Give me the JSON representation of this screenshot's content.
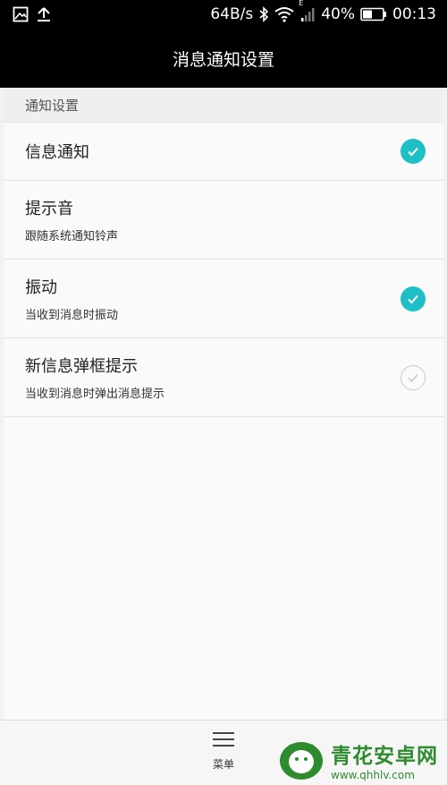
{
  "status_bar": {
    "net_speed": "64B/s",
    "signal_letter": "E",
    "battery": "40%",
    "time": "00:13"
  },
  "title": "消息通知设置",
  "section_header": "通知设置",
  "settings": [
    {
      "title": "信息通知",
      "subtitle": "",
      "checked": true
    },
    {
      "title": "提示音",
      "subtitle": "跟随系统通知铃声",
      "checked": null
    },
    {
      "title": "振动",
      "subtitle": "当收到消息时振动",
      "checked": true
    },
    {
      "title": "新信息弹框提示",
      "subtitle": "当收到消息时弹出消息提示",
      "checked": false
    }
  ],
  "bottom_bar": {
    "menu_label": "菜单"
  },
  "watermark": {
    "name": "青花安卓网",
    "url": "www.qhhlv.com"
  },
  "colors": {
    "accent": "#1ec0c6",
    "watermark": "#2e8b2e"
  }
}
